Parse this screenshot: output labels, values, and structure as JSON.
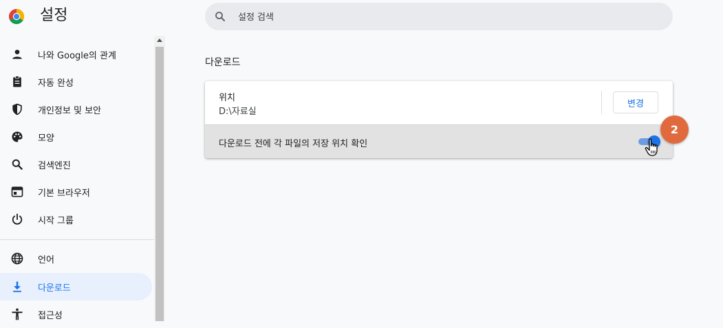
{
  "header": {
    "title": "설정",
    "search_placeholder": "설정 검색"
  },
  "sidebar": {
    "items": [
      {
        "label": "나와 Google의 관계",
        "icon": "person-icon"
      },
      {
        "label": "자동 완성",
        "icon": "clipboard-icon"
      },
      {
        "label": "개인정보 및 보안",
        "icon": "shield-icon"
      },
      {
        "label": "모양",
        "icon": "palette-icon"
      },
      {
        "label": "검색엔진",
        "icon": "search-icon"
      },
      {
        "label": "기본 브라우저",
        "icon": "browser-window-icon"
      },
      {
        "label": "시작 그룹",
        "icon": "power-icon"
      },
      {
        "label": "언어",
        "icon": "globe-icon"
      },
      {
        "label": "다운로드",
        "icon": "download-icon",
        "active": true
      },
      {
        "label": "접근성",
        "icon": "accessibility-icon"
      }
    ]
  },
  "main": {
    "section_title": "다운로드",
    "location": {
      "label": "위치",
      "value": "D:\\자료실",
      "change_button": "변경"
    },
    "ask_where_to_save": {
      "label": "다운로드 전에 각 파일의 저장 위치 확인",
      "enabled": true
    }
  },
  "overlay": {
    "step_badge": "2"
  },
  "colors": {
    "accent": "#1a73e8",
    "active_nav_bg": "#e8f0fe",
    "badge": "#e06a3e"
  }
}
